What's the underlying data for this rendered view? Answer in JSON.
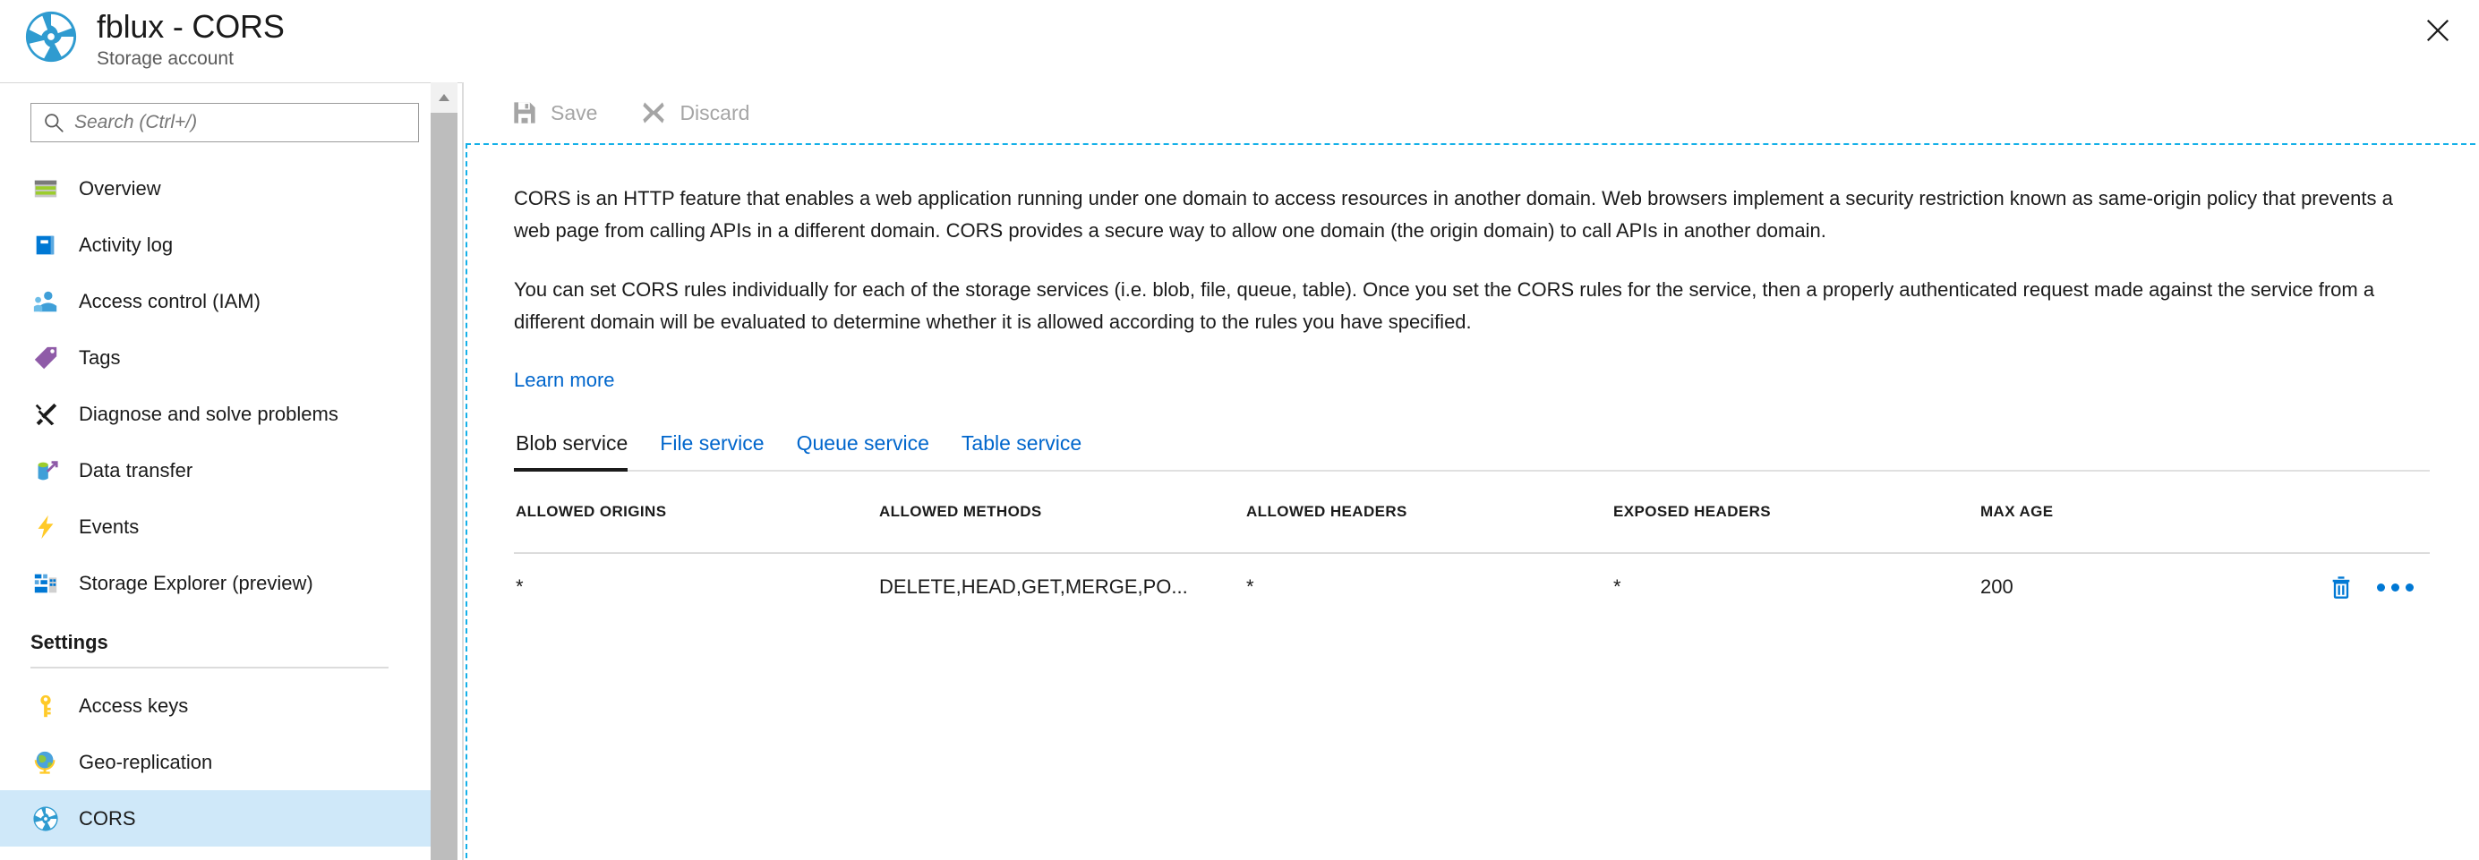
{
  "header": {
    "title": "fblux - CORS",
    "subtitle": "Storage account",
    "icon": "storage-account-icon",
    "close_label": "Close"
  },
  "sidebar": {
    "search": {
      "placeholder": "Search (Ctrl+/)",
      "value": "",
      "icon": "search-icon"
    },
    "collapse": {
      "glyph": "«",
      "name": "collapse-sidebar-button"
    },
    "items": [
      {
        "label": "Overview",
        "icon": "overview-icon",
        "selected": false
      },
      {
        "label": "Activity log",
        "icon": "activity-log-icon",
        "selected": false
      },
      {
        "label": "Access control (IAM)",
        "icon": "access-control-icon",
        "selected": false
      },
      {
        "label": "Tags",
        "icon": "tags-icon",
        "selected": false
      },
      {
        "label": "Diagnose and solve problems",
        "icon": "diagnose-icon",
        "selected": false
      },
      {
        "label": "Data transfer",
        "icon": "data-transfer-icon",
        "selected": false
      },
      {
        "label": "Events",
        "icon": "events-icon",
        "selected": false
      },
      {
        "label": "Storage Explorer (preview)",
        "icon": "storage-explorer-icon",
        "selected": false
      }
    ],
    "settings_section": {
      "title": "Settings",
      "items": [
        {
          "label": "Access keys",
          "icon": "key-icon",
          "selected": false
        },
        {
          "label": "Geo-replication",
          "icon": "globe-icon",
          "selected": false
        },
        {
          "label": "CORS",
          "icon": "cors-icon",
          "selected": true
        }
      ]
    }
  },
  "toolbar": {
    "save_label": "Save",
    "save_icon": "save-icon",
    "discard_label": "Discard",
    "discard_icon": "discard-icon"
  },
  "content": {
    "paragraph_1": "CORS is an HTTP feature that enables a web application running under one domain to access resources in another domain. Web browsers implement a security restriction known as same-origin policy that prevents a web page from calling APIs in a different domain. CORS provides a secure way to allow one domain (the origin domain) to call APIs in another domain.",
    "paragraph_2": "You can set CORS rules individually for each of the storage services (i.e. blob, file, queue, table). Once you set the CORS rules for the service, then a properly authenticated request made against the service from a different domain will be evaluated to determine whether it is allowed according to the rules you have specified.",
    "learn_more": "Learn more"
  },
  "tabs": [
    {
      "label": "Blob service",
      "active": true
    },
    {
      "label": "File service",
      "active": false
    },
    {
      "label": "Queue service",
      "active": false
    },
    {
      "label": "Table service",
      "active": false
    }
  ],
  "table": {
    "columns": [
      "ALLOWED ORIGINS",
      "ALLOWED METHODS",
      "ALLOWED HEADERS",
      "EXPOSED HEADERS",
      "MAX AGE"
    ],
    "rows": [
      {
        "allowed_origins": "*",
        "allowed_methods": "DELETE,HEAD,GET,MERGE,PO...",
        "allowed_headers": "*",
        "exposed_headers": "*",
        "max_age": "200",
        "actions": {
          "delete_icon": "trash-icon",
          "more_icon": "ellipsis-icon"
        }
      }
    ]
  },
  "colors": {
    "accent": "#0078d4",
    "link": "#0066cc",
    "selected_row": "#cfe8f9",
    "focus_dashed": "#14b0e8",
    "disabled_text": "#a5a5a5"
  }
}
